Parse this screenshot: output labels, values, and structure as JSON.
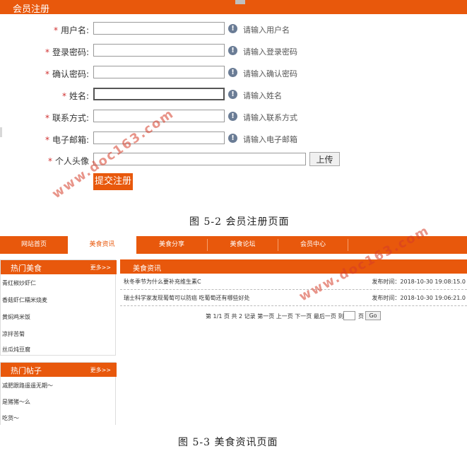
{
  "registration": {
    "header_title": "会员注册",
    "fields": [
      {
        "label": "用户名:",
        "hint": "请输入用户名"
      },
      {
        "label": "登录密码:",
        "hint": "请输入登录密码"
      },
      {
        "label": "确认密码:",
        "hint": "请输入确认密码"
      },
      {
        "label": "姓名:",
        "hint": "请输入姓名"
      },
      {
        "label": "联系方式:",
        "hint": "请输入联系方式"
      },
      {
        "label": "电子邮箱:",
        "hint": "请输入电子邮箱"
      }
    ],
    "required_mark": "*",
    "info_glyph": "!",
    "avatar_label": "个人头像",
    "upload_label": "上传",
    "submit_label": "提交注册"
  },
  "captions": {
    "fig_2": "图 5-2 会员注册页面",
    "fig_3": "图 5-3 美食资讯页面"
  },
  "news_page": {
    "nav": [
      "网站首页",
      "美食资讯",
      "美食分享",
      "美食论坛",
      "会员中心"
    ],
    "active_nav": "美食资讯",
    "hot_food": {
      "title": "热门美食",
      "more": "更多>>",
      "items": [
        "青红椒炒虾仁",
        "香菇虾仁糯米烧麦",
        "黄焖鸡米饭",
        "凉拌苦菊",
        "丝瓜炖豆腐"
      ]
    },
    "hot_posts": {
      "title": "热门帖子",
      "more": "更多>>",
      "items": [
        "减肥跟路遥遥无期～",
        "是猪猪～么",
        "吃货～"
      ]
    },
    "news": {
      "title": "美食资讯",
      "rows": [
        {
          "title": "秋冬季节为什么要补充维生素C",
          "date": "发布时间：2018-10-30 19:08:15.0"
        },
        {
          "title": "瑞士科学家发现葡萄可以防癌 吃葡萄还有哪些好处",
          "date": "发布时间：2018-10-30 19:06:21.0"
        }
      ],
      "pager_text": "第 1/1 页 共 2 记录 第一页 上一页 下一页 最后一页 到",
      "pager_suffix": "页",
      "go_label": "Go"
    }
  },
  "watermark": "www.doc163.com",
  "colors": {
    "accent": "#e8580c",
    "watermark": "#d63c28"
  }
}
